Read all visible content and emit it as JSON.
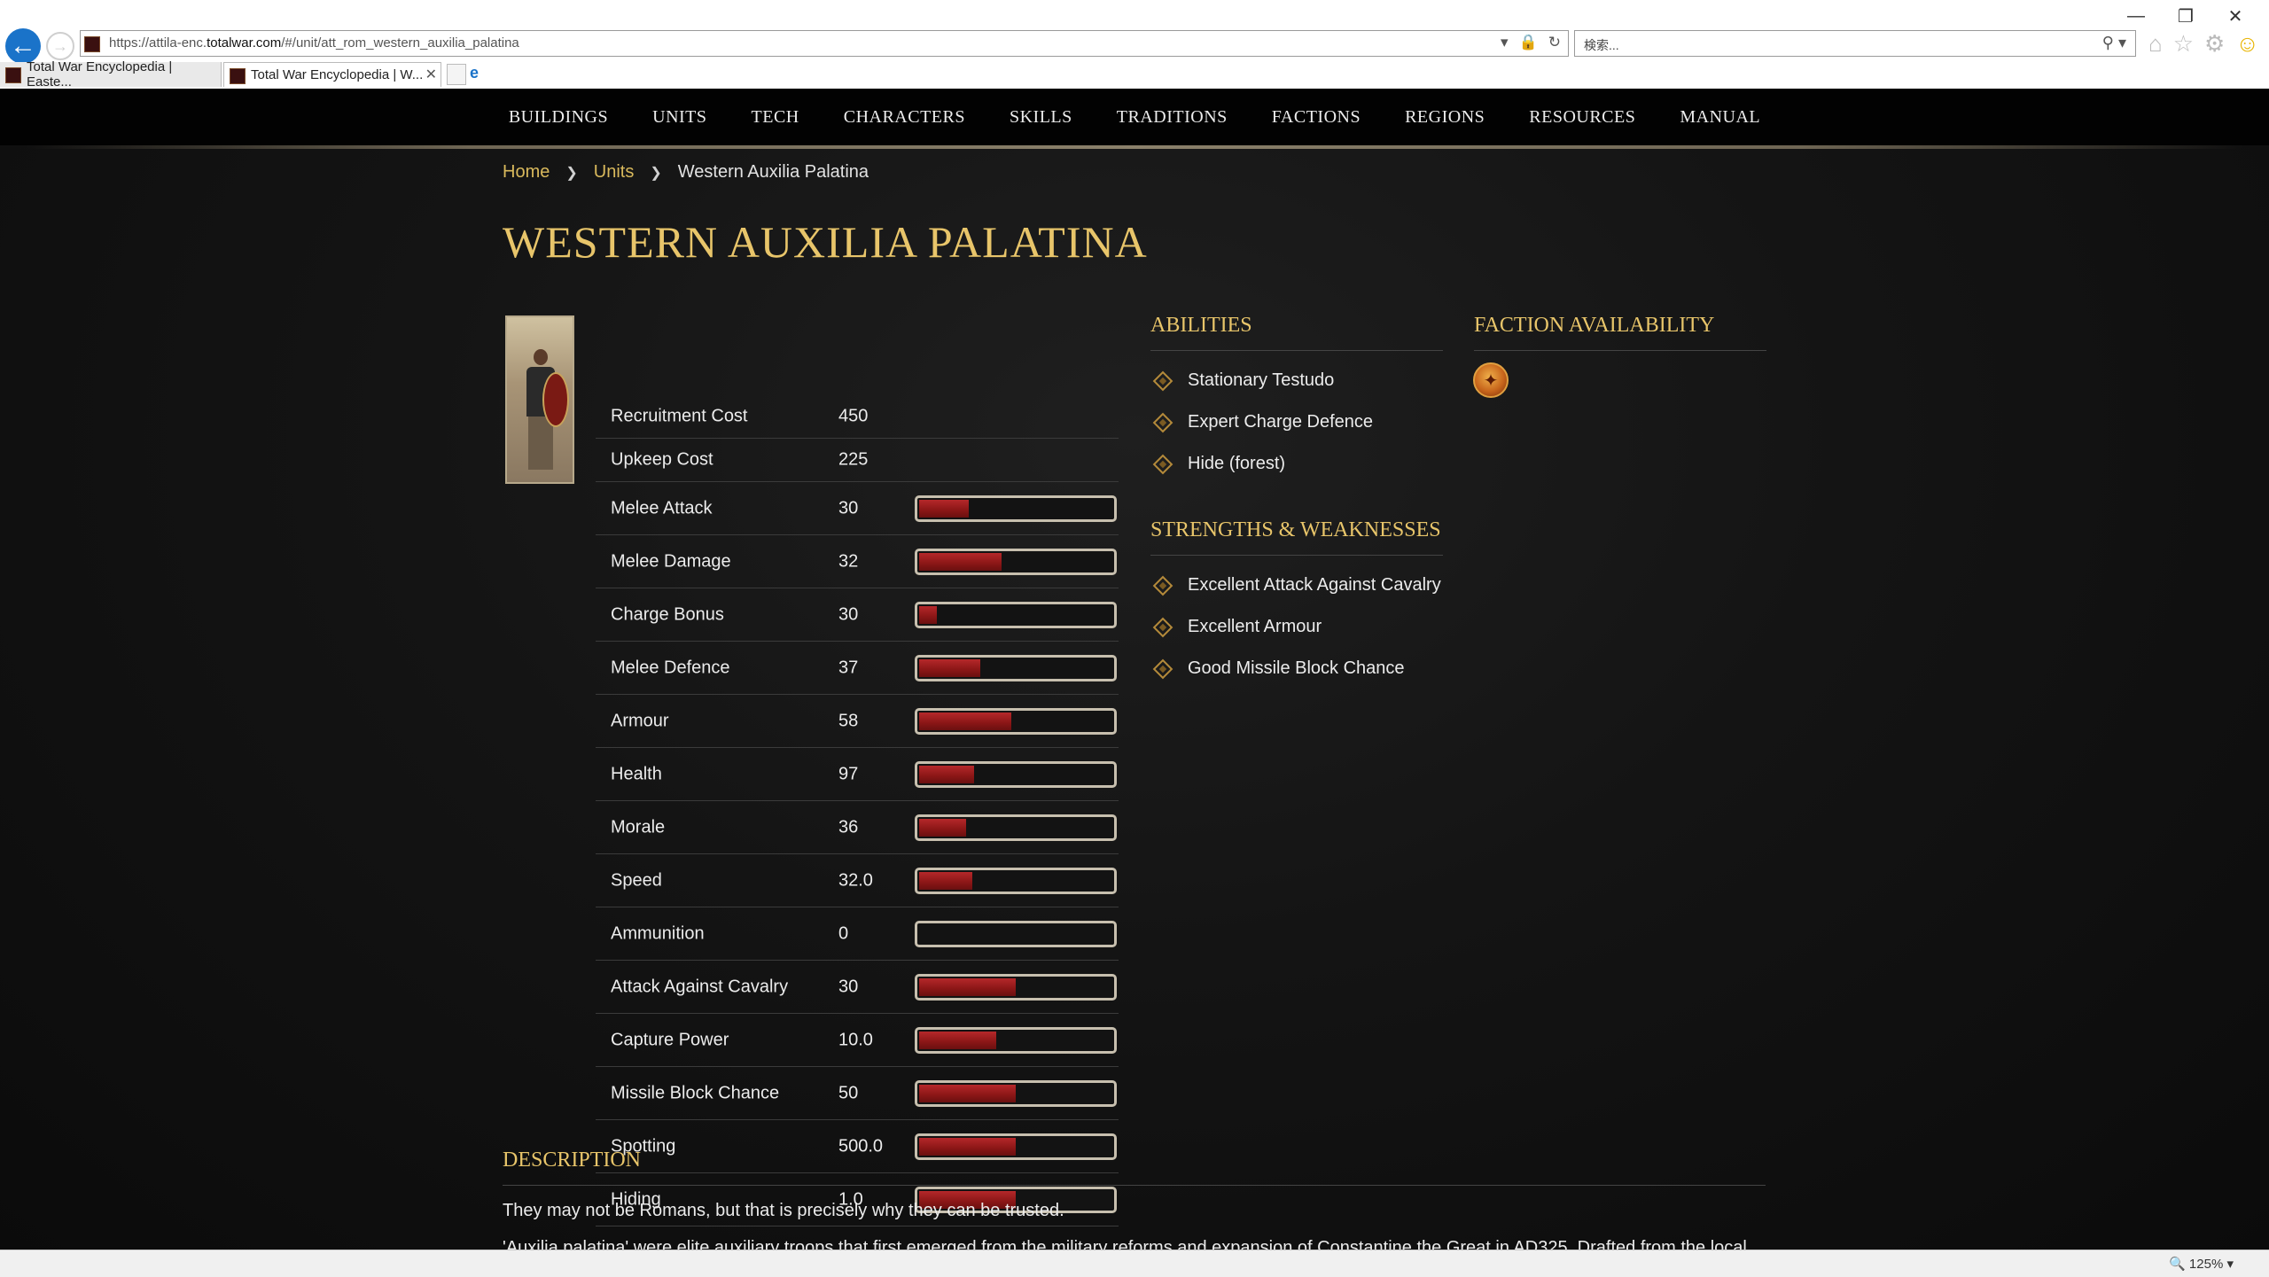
{
  "browser": {
    "url_prefix": "https://attila-enc.",
    "url_domain": "totalwar.com",
    "url_suffix": "/#/unit/att_rom_western_auxilia_palatina",
    "search_placeholder": "検索...",
    "tabs": [
      {
        "label": "Total War Encyclopedia | Easte...",
        "active": false
      },
      {
        "label": "Total War Encyclopedia | W...",
        "active": true
      }
    ],
    "zoom": "125%"
  },
  "nav": {
    "items": [
      "BUILDINGS",
      "UNITS",
      "TECH",
      "CHARACTERS",
      "SKILLS",
      "TRADITIONS",
      "FACTIONS",
      "REGIONS",
      "RESOURCES",
      "MANUAL"
    ]
  },
  "breadcrumb": {
    "home": "Home",
    "units": "Units",
    "current": "Western Auxilia Palatina"
  },
  "unit": {
    "title": "WESTERN AUXILIA PALATINA",
    "stats": [
      {
        "label": "Recruitment Cost",
        "value": "450"
      },
      {
        "label": "Upkeep Cost",
        "value": "225"
      },
      {
        "label": "Melee Attack",
        "value": "30",
        "bar": 0.25
      },
      {
        "label": "Melee Damage",
        "value": "32",
        "bar": 0.42
      },
      {
        "label": "Charge Bonus",
        "value": "30",
        "bar": 0.09
      },
      {
        "label": "Melee Defence",
        "value": "37",
        "bar": 0.31
      },
      {
        "label": "Armour",
        "value": "58",
        "bar": 0.47
      },
      {
        "label": "Health",
        "value": "97",
        "bar": 0.28
      },
      {
        "label": "Morale",
        "value": "36",
        "bar": 0.24
      },
      {
        "label": "Speed",
        "value": "32.0",
        "bar": 0.27
      },
      {
        "label": "Ammunition",
        "value": "0",
        "bar": 0.0
      },
      {
        "label": "Attack Against Cavalry",
        "value": "30",
        "bar": 0.49
      },
      {
        "label": "Capture Power",
        "value": "10.0",
        "bar": 0.39
      },
      {
        "label": "Missile Block Chance",
        "value": "50",
        "bar": 0.49
      },
      {
        "label": "Spotting",
        "value": "500.0",
        "bar": 0.49
      },
      {
        "label": "Hiding",
        "value": "1.0",
        "bar": 0.49
      }
    ]
  },
  "abilities": {
    "title": "ABILITIES",
    "items": [
      "Stationary Testudo",
      "Expert Charge Defence",
      "Hide (forest)"
    ]
  },
  "strengths": {
    "title": "STRENGTHS & WEAKNESSES",
    "items": [
      "Excellent Attack Against Cavalry",
      "Excellent Armour",
      "Good Missile Block Chance"
    ]
  },
  "faction": {
    "title": "FACTION AVAILABILITY"
  },
  "description": {
    "title": "DESCRIPTION",
    "p1": "They may not be Romans, but that is precisely why they can be trusted.",
    "p2": "'Auxilia palatina' were elite auxiliary troops that first emerged from the military reforms and expansion of Constantine the Great in AD325. Drafted from the local"
  },
  "colors": {
    "gold": "#e8c56a",
    "link": "#d9b95c",
    "bar_fill": "#a81e20"
  }
}
